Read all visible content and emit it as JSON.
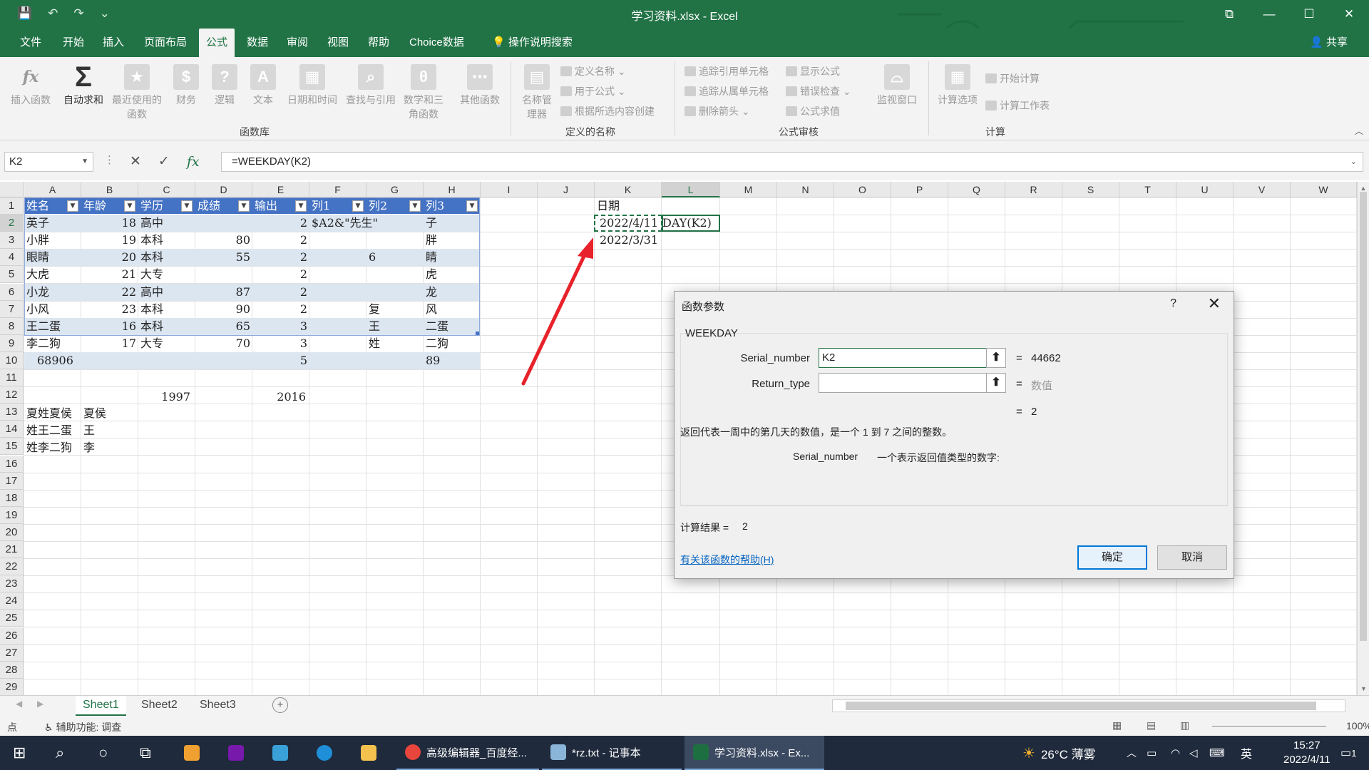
{
  "window": {
    "title": "学习资料.xlsx - Excel",
    "qat": [
      "💾",
      "↶",
      "↷",
      "⌄"
    ],
    "controls": [
      "⧉",
      "—",
      "☐",
      "✕"
    ]
  },
  "menu": {
    "tabs": [
      "文件",
      "开始",
      "插入",
      "页面布局",
      "公式",
      "数据",
      "审阅",
      "视图",
      "帮助",
      "Choice数据",
      "操作说明搜索"
    ],
    "active_tab": "公式",
    "share": "共享"
  },
  "ribbon": {
    "function_library": {
      "label": "函数库",
      "buttons": [
        "插入函数",
        "自动求和",
        "最近使用的函数",
        "财务",
        "逻辑",
        "文本",
        "日期和时间",
        "查找与引用",
        "数学和三角函数",
        "其他函数"
      ]
    },
    "defined_names": {
      "label": "定义的名称",
      "manager": "名称管理器",
      "items": [
        "定义名称",
        "用于公式",
        "根据所选内容创建"
      ]
    },
    "formula_auditing": {
      "label": "公式审核",
      "items": [
        "追踪引用单元格",
        "追踪从属单元格",
        "删除箭头",
        "显示公式",
        "错误检查",
        "公式求值"
      ],
      "watch": "监视窗口"
    },
    "calculation": {
      "label": "计算",
      "options": "计算选项",
      "items": [
        "开始计算",
        "计算工作表"
      ]
    }
  },
  "formula_bar": {
    "name_box": "K2",
    "formula": "=WEEKDAY(K2)"
  },
  "columns": [
    "A",
    "B",
    "C",
    "D",
    "E",
    "F",
    "G",
    "H",
    "I",
    "J",
    "K",
    "L",
    "M",
    "N",
    "O",
    "P",
    "Q",
    "R",
    "S",
    "T",
    "U",
    "V",
    "W"
  ],
  "selected_column": "L",
  "rows": [
    "1",
    "2",
    "3",
    "4",
    "5",
    "6",
    "7",
    "8",
    "9",
    "10",
    "11",
    "12",
    "13",
    "14",
    "15",
    "16",
    "17",
    "18",
    "19",
    "20",
    "21",
    "22",
    "23",
    "24",
    "25",
    "26",
    "27",
    "28",
    "29"
  ],
  "selected_row": "2",
  "table": {
    "headers": [
      "姓名",
      "年龄",
      "学历",
      "成绩",
      "输出",
      "列1",
      "列2",
      "列3"
    ],
    "rows": [
      [
        "英子",
        "18",
        "高中",
        "",
        "2",
        "$A2&\"先生\"",
        "",
        "子"
      ],
      [
        "小胖",
        "19",
        "本科",
        "80",
        "2",
        "",
        "",
        "胖"
      ],
      [
        "眼睛",
        "20",
        "本科",
        "55",
        "2",
        "",
        "6",
        "睛"
      ],
      [
        "大虎",
        "21",
        "大专",
        "",
        "2",
        "",
        "",
        "虎"
      ],
      [
        "小龙",
        "22",
        "高中",
        "87",
        "2",
        "",
        "",
        "龙"
      ],
      [
        "小风",
        "23",
        "本科",
        "90",
        "2",
        "",
        "复",
        "风"
      ],
      [
        "王二蛋",
        "16",
        "本科",
        "65",
        "3",
        "",
        "王",
        "二蛋"
      ],
      [
        "李二狗",
        "17",
        "大专",
        "70",
        "3",
        "",
        "姓",
        "二狗"
      ]
    ],
    "total": [
      "68906",
      "",
      "",
      "",
      "5",
      "",
      "",
      "89"
    ]
  },
  "extra_cells": {
    "c12": "1997",
    "e12": "2016",
    "a13": "夏姓夏侯",
    "b13": "夏侯",
    "a14": "姓王二蛋",
    "b14": "王",
    "a15": "姓李二狗",
    "b15": "李",
    "k1": "日期",
    "k2": "2022/4/11",
    "l2_overflow": "DAY(K2)",
    "k3": "2022/3/31"
  },
  "dialog": {
    "title": "函数参数",
    "help_glyph": "?",
    "close_glyph": "✕",
    "function_name": "WEEKDAY",
    "args": [
      {
        "label": "Serial_number",
        "value": "K2",
        "result": "44662",
        "result_gray": false
      },
      {
        "label": "Return_type",
        "value": "",
        "result": "数值",
        "result_gray": true
      }
    ],
    "overall_eq": "=",
    "overall_result": "2",
    "description": "返回代表一周中的第几天的数值，是一个 1 到 7 之间的整数。",
    "arg_help_name": "Serial_number",
    "arg_help_text": "一个表示返回值类型的数字:",
    "calc_result_label": "计算结果 =",
    "calc_result_value": "2",
    "help_link": "有关该函数的帮助(H)",
    "ok": "确定",
    "cancel": "取消"
  },
  "sheets": [
    "Sheet1",
    "Sheet2",
    "Sheet3"
  ],
  "active_sheet": "Sheet1",
  "statusbar": {
    "mode": "点",
    "accessibility": "辅助功能: 调查",
    "zoom": "100%"
  },
  "taskbar": {
    "apps": [
      {
        "label": "高级编辑器_百度经...",
        "color": "#e8453c"
      },
      {
        "label": "*rz.txt - 记事本",
        "color": "#8ab4d8"
      },
      {
        "label": "学习资料.xlsx - Ex...",
        "color": "#1d6f42"
      }
    ],
    "weather": "26°C 薄雾",
    "ime": "英",
    "time": "15:27",
    "date": "2022/4/11",
    "notif_count": "1"
  },
  "colors": {
    "excel_green": "#217346",
    "table_header": "#4472c4",
    "table_band": "#dce6f1",
    "arrow_red": "#e8222a"
  }
}
